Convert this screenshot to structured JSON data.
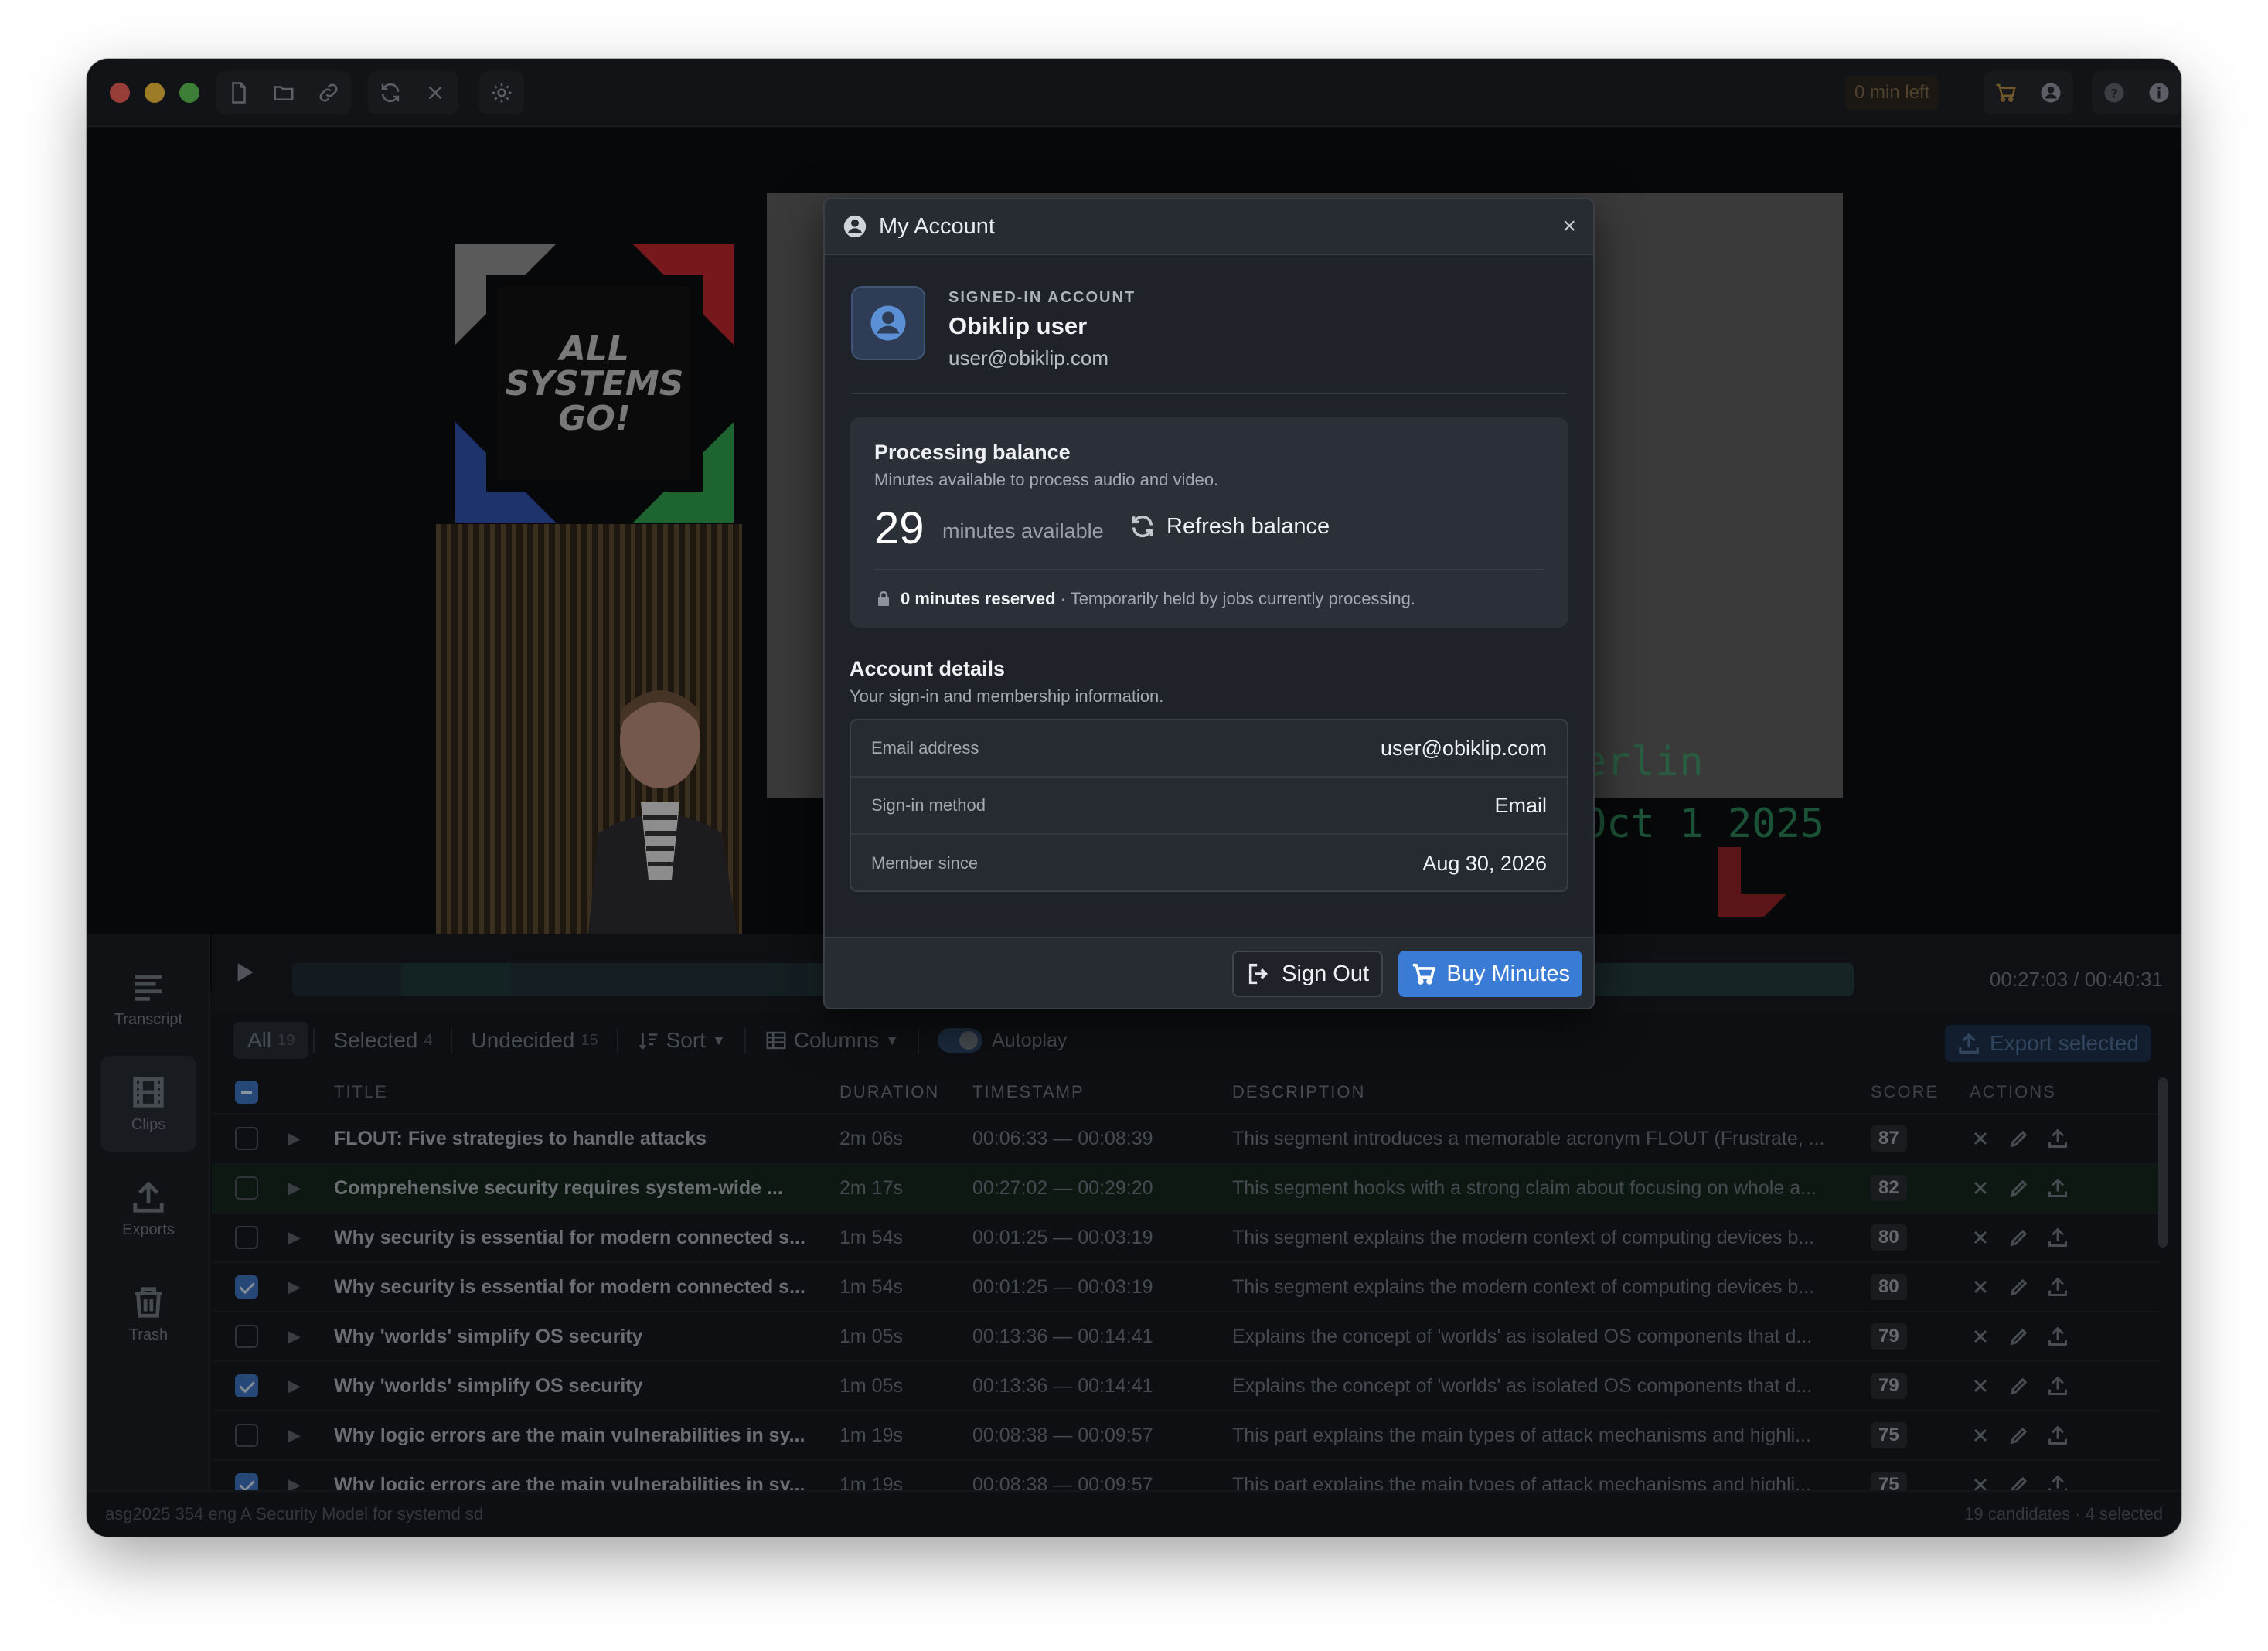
{
  "toolbar": {
    "left_buttons": [
      "new-file-icon",
      "open-folder-icon",
      "link-icon",
      "refresh-icon",
      "close-icon",
      "settings-icon"
    ],
    "minutes_left": "0 min left",
    "right_buttons": [
      "cart-icon",
      "account-icon",
      "help-icon",
      "info-icon"
    ]
  },
  "video": {
    "logo_text": [
      "ALL",
      "SYSTEMS",
      "GO!"
    ],
    "overlay_lines": [
      "erlin",
      "Oct 1 2025"
    ]
  },
  "sidebar": {
    "items": [
      {
        "label": "Transcript",
        "icon": "transcript-icon"
      },
      {
        "label": "Clips",
        "icon": "film-icon"
      },
      {
        "label": "Exports",
        "icon": "export-icon"
      },
      {
        "label": "Trash",
        "icon": "trash-icon"
      }
    ]
  },
  "transport": {
    "timecode": "00:27:03 / 00:40:31"
  },
  "filters": {
    "all": {
      "label": "All",
      "count": "19"
    },
    "selected": {
      "label": "Selected",
      "count": "4"
    },
    "undecided": {
      "label": "Undecided",
      "count": "15"
    },
    "sort": "Sort",
    "columns": "Columns",
    "autoplay": "Autoplay",
    "export_selected": "Export selected"
  },
  "table": {
    "headers": {
      "title": "TITLE",
      "duration": "DURATION",
      "timestamp": "TIMESTAMP",
      "description": "DESCRIPTION",
      "score": "SCORE",
      "actions": "ACTIONS"
    },
    "rows": [
      {
        "checked": false,
        "title": "FLOUT: Five strategies to handle attacks",
        "duration": "2m 06s",
        "timestamp": "00:06:33 — 00:08:39",
        "description": "This segment introduces a memorable acronym FLOUT (Frustrate, ...",
        "score": "87"
      },
      {
        "checked": false,
        "title": "Comprehensive security requires system-wide ...",
        "duration": "2m 17s",
        "timestamp": "00:27:02 — 00:29:20",
        "description": "This segment hooks with a strong claim about focusing on whole a...",
        "score": "82"
      },
      {
        "checked": false,
        "title": "Why security is essential for modern connected s...",
        "duration": "1m 54s",
        "timestamp": "00:01:25 — 00:03:19",
        "description": "This segment explains the modern context of computing devices b...",
        "score": "80"
      },
      {
        "checked": true,
        "title": "Why security is essential for modern connected s...",
        "duration": "1m 54s",
        "timestamp": "00:01:25 — 00:03:19",
        "description": "This segment explains the modern context of computing devices b...",
        "score": "80"
      },
      {
        "checked": false,
        "title": "Why 'worlds' simplify OS security",
        "duration": "1m 05s",
        "timestamp": "00:13:36 — 00:14:41",
        "description": "Explains the concept of 'worlds' as isolated OS components that d...",
        "score": "79"
      },
      {
        "checked": true,
        "title": "Why 'worlds' simplify OS security",
        "duration": "1m 05s",
        "timestamp": "00:13:36 — 00:14:41",
        "description": "Explains the concept of 'worlds' as isolated OS components that d...",
        "score": "79"
      },
      {
        "checked": false,
        "title": "Why logic errors are the main vulnerabilities in sy...",
        "duration": "1m 19s",
        "timestamp": "00:08:38 — 00:09:57",
        "description": "This part explains the main types of attack mechanisms and highli...",
        "score": "75"
      },
      {
        "checked": true,
        "title": "Why logic errors are the main vulnerabilities in sy...",
        "duration": "1m 19s",
        "timestamp": "00:08:38 — 00:09:57",
        "description": "This part explains the main types of attack mechanisms and highli...",
        "score": "75"
      }
    ]
  },
  "statusbar": {
    "left": "asg2025 354 eng A Security Model for systemd sd",
    "right": "19 candidates · 4 selected"
  },
  "modal": {
    "title": "My Account",
    "close": "×",
    "account_label": "SIGNED-IN ACCOUNT",
    "account_name": "Obiklip user",
    "account_email": "user@obiklip.com",
    "balance": {
      "title": "Processing balance",
      "subtitle": "Minutes available to process audio and video.",
      "minutes": "29",
      "unit": "minutes available",
      "refresh": "Refresh balance",
      "reserved": "0 minutes reserved",
      "reserved_note": " · Temporarily held by jobs currently processing."
    },
    "details": {
      "title": "Account details",
      "subtitle": "Your sign-in and membership information.",
      "rows": [
        {
          "key": "Email address",
          "value": "user@obiklip.com"
        },
        {
          "key": "Sign-in method",
          "value": "Email"
        },
        {
          "key": "Member since",
          "value": "Aug 30, 2026"
        }
      ]
    },
    "sign_out": "Sign Out",
    "buy_minutes": "Buy Minutes"
  },
  "colors": {
    "accent": "#3a7bd5",
    "highlight_row": "#16261d"
  }
}
